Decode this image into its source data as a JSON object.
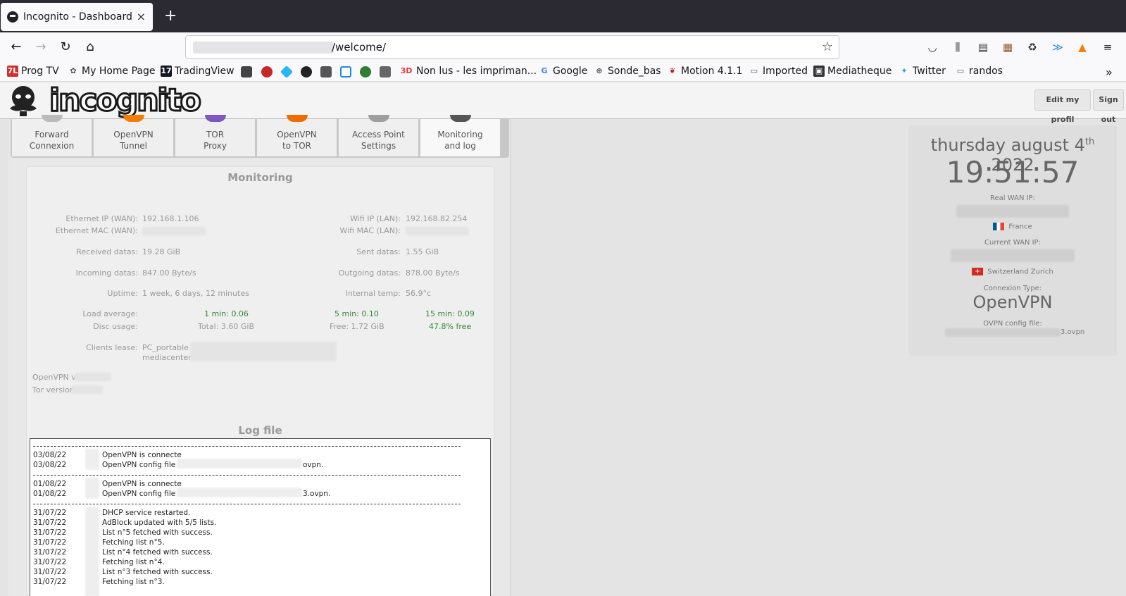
{
  "browser": {
    "tab_title": "Incognito - Dashboard",
    "tab_close": "×",
    "new_tab": "+",
    "url_path": "/welcome/"
  },
  "bookmarks": [
    {
      "label": "Prog TV",
      "color": "#d32f2f",
      "glyph": "7L"
    },
    {
      "label": "My Home Page",
      "color": "#555555",
      "glyph": "✿"
    },
    {
      "label": "TradingView",
      "color": "#131722",
      "glyph": "17"
    },
    {
      "label": "Non lus - les impriman...",
      "color": "#e53935",
      "glyph": "3D"
    },
    {
      "label": "Google",
      "color": "#4285f4",
      "glyph": "G"
    },
    {
      "label": "Sonde_bas",
      "color": "#555555",
      "glyph": "⊕"
    },
    {
      "label": "Motion 4.1.1",
      "color": "#b71c1c",
      "glyph": "❦"
    },
    {
      "label": "Imported",
      "color": "#555555",
      "glyph": "▭"
    },
    {
      "label": "Mediatheque",
      "color": "#333333",
      "glyph": "▣"
    },
    {
      "label": "Twitter",
      "color": "#1da1f2",
      "glyph": "✦"
    },
    {
      "label": "randos",
      "color": "#555555",
      "glyph": "▭"
    }
  ],
  "header": {
    "logo_text": "incognito",
    "edit_profile": "Edit my profil",
    "sign_out": "Sign out"
  },
  "tabs": [
    {
      "line1": "Forward",
      "line2": "Connexion"
    },
    {
      "line1": "OpenVPN",
      "line2": "Tunnel"
    },
    {
      "line1": "TOR",
      "line2": "Proxy"
    },
    {
      "line1": "OpenVPN",
      "line2": "to TOR"
    },
    {
      "line1": "Access Point",
      "line2": "Settings"
    },
    {
      "line1": "Monitoring",
      "line2": "and log"
    }
  ],
  "monitoring": {
    "title": "Monitoring",
    "eth_ip_label": "Ethernet IP (WAN):",
    "eth_ip": "192.168.1.106",
    "eth_mac_label": "Ethernet MAC (WAN):",
    "wifi_ip_label": "Wifi IP (LAN):",
    "wifi_ip": "192.168.82.254",
    "wifi_mac_label": "Wifi MAC (LAN):",
    "received_label": "Received datas:",
    "received": "19.28 GiB",
    "sent_label": "Sent datas:",
    "sent": "1.55 GiB",
    "incoming_label": "Incoming datas:",
    "incoming": "847.00 Byte/s",
    "outgoing_label": "Outgoing datas:",
    "outgoing": "878.00 Byte/s",
    "uptime_label": "Uptime:",
    "uptime": "1 week, 6 days, 12 minutes",
    "temp_label": "Internal temp:",
    "temp": "56.9°c",
    "load_label": "Load average:",
    "load_1": "1 min: 0.06",
    "load_5": "5 min: 0.10",
    "load_15": "15 min: 0.09",
    "disc_label": "Disc usage:",
    "disc_total": "Total: 3.60 GiB",
    "disc_free": "Free: 1.72 GiB",
    "disc_pct": "47.8% free",
    "clients_label": "Clients lease:",
    "client_1": "PC_portable -",
    "client_2": "mediacenter -",
    "openvpn_ver": "OpenVPN ve",
    "tor_ver": "Tor version"
  },
  "log": {
    "title": "Log file",
    "entries": [
      {
        "date": "03/08/22",
        "msg": "OpenVPN is connecte"
      },
      {
        "date": "03/08/22",
        "msg": "OpenVPN config file :"
      },
      {
        "date": "01/08/22",
        "msg": "OpenVPN is connecte"
      },
      {
        "date": "01/08/22",
        "msg": "OpenVPN config file :"
      },
      {
        "date": "31/07/22",
        "msg": "DHCP service restarted."
      },
      {
        "date": "31/07/22",
        "msg": "AdBlock updated with 5/5 lists."
      },
      {
        "date": "31/07/22",
        "msg": "List n°5 fetched with success."
      },
      {
        "date": "31/07/22",
        "msg": "Fetching list n°5."
      },
      {
        "date": "31/07/22",
        "msg": "List n°4 fetched with success."
      },
      {
        "date": "31/07/22",
        "msg": "Fetching list n°4."
      },
      {
        "date": "31/07/22",
        "msg": "List n°3 fetched with success."
      },
      {
        "date": "31/07/22",
        "msg": "Fetching list n°3."
      }
    ],
    "ovpn_suffix_1": "ovpn.",
    "ovpn_suffix_2": "3.ovpn."
  },
  "clock": {
    "date_pre": "thursday august 4",
    "date_sup": "th",
    "date_post": " 2022",
    "time": "19:51:57",
    "real_ip_label": "Real WAN IP:",
    "real_country": "France",
    "current_ip_label": "Current WAN IP:",
    "current_country": "Switzerland Zurich",
    "connexion_label": "Connexion Type:",
    "connexion": "OpenVPN",
    "ovpn_label": "OVPN config file:",
    "ovpn_file": "3.ovpn"
  }
}
